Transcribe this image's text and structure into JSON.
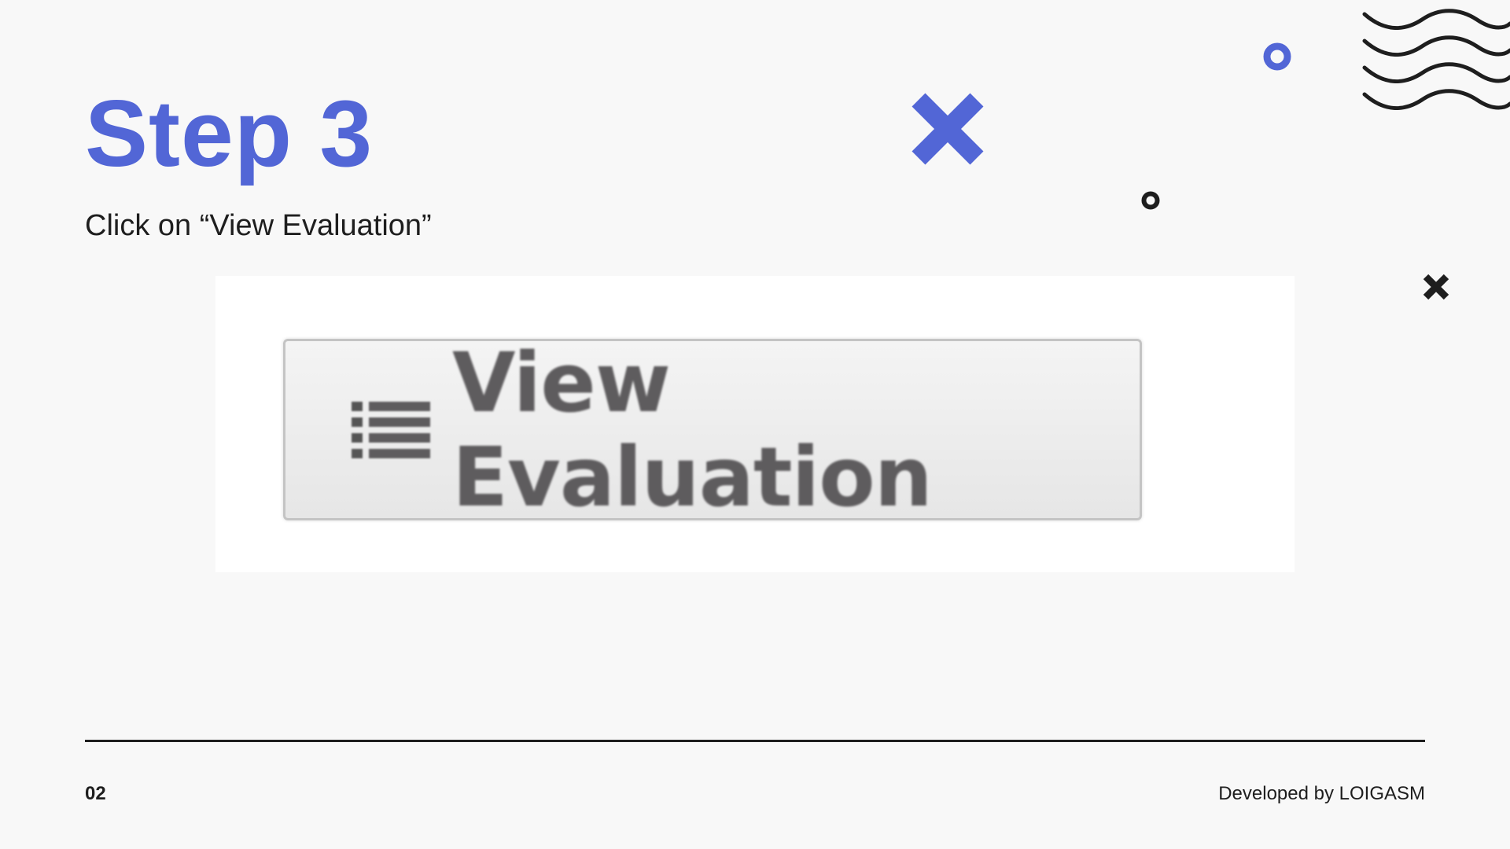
{
  "slide": {
    "title": "Step 3",
    "instruction": "Click on “View Evaluation”",
    "page_number": "02",
    "credit": "Developed by LOIGASM"
  },
  "screenshot": {
    "button_label": "View Evaluation",
    "button_icon": "list-icon"
  },
  "colors": {
    "accent": "#5266d6",
    "text": "#1e1e1e",
    "background": "#f8f8f8"
  },
  "decorations": [
    "blue-cross-icon",
    "blue-ring-icon",
    "black-ring-icon",
    "black-cross-icon",
    "wave-lines-icon"
  ]
}
